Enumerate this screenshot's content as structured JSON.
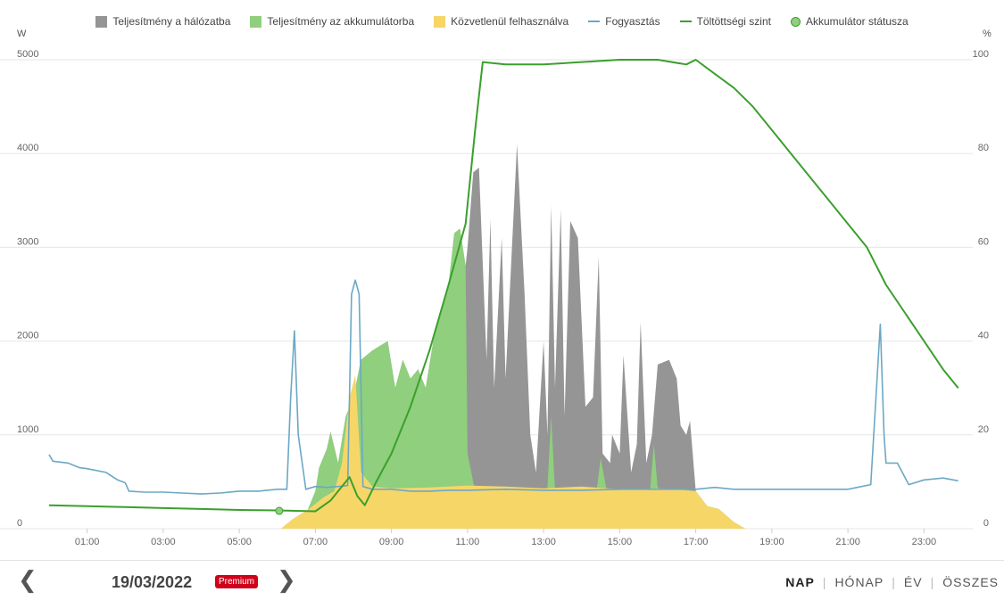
{
  "chart_data": {
    "type": "area",
    "y_left_unit": "W",
    "y_right_unit": "%",
    "y_left_ticks": [
      "0",
      "1000",
      "2000",
      "3000",
      "4000",
      "5000"
    ],
    "y_right_ticks": [
      "0",
      "20",
      "40",
      "60",
      "80",
      "100"
    ],
    "ylim_left": [
      0,
      5000
    ],
    "ylim_right": [
      0,
      100
    ],
    "x_ticks": [
      "01:00",
      "03:00",
      "05:00",
      "07:00",
      "09:00",
      "11:00",
      "13:00",
      "15:00",
      "17:00",
      "19:00",
      "21:00",
      "23:00"
    ],
    "grid": true,
    "legend_position": "top",
    "series": [
      {
        "name": "Közvetlenül felhasználva",
        "kind": "area",
        "unit": "W",
        "color": "#f7d668",
        "points": [
          [
            6.1,
            0
          ],
          [
            6.4,
            100
          ],
          [
            6.8,
            200
          ],
          [
            7.2,
            330
          ],
          [
            7.5,
            400
          ],
          [
            7.7,
            700
          ],
          [
            7.9,
            1400
          ],
          [
            8.05,
            1640
          ],
          [
            8.2,
            600
          ],
          [
            8.5,
            450
          ],
          [
            9,
            430
          ],
          [
            10,
            440
          ],
          [
            11,
            460
          ],
          [
            12,
            450
          ],
          [
            13,
            430
          ],
          [
            14,
            450
          ],
          [
            15,
            420
          ],
          [
            16,
            430
          ],
          [
            16.5,
            420
          ],
          [
            17,
            400
          ],
          [
            17.3,
            240
          ],
          [
            17.6,
            210
          ],
          [
            18,
            70
          ],
          [
            18.3,
            0
          ]
        ]
      },
      {
        "name": "Teljesítmény az akkumulátorba",
        "kind": "area",
        "unit": "W",
        "color": "#8fcf7d",
        "points": [
          [
            6.1,
            0
          ],
          [
            6.4,
            100
          ],
          [
            6.8,
            200
          ],
          [
            7,
            400
          ],
          [
            7.1,
            650
          ],
          [
            7.3,
            850
          ],
          [
            7.4,
            1030
          ],
          [
            7.6,
            700
          ],
          [
            7.8,
            1200
          ],
          [
            8,
            1400
          ],
          [
            8.2,
            1800
          ],
          [
            8.5,
            1900
          ],
          [
            8.9,
            2000
          ],
          [
            9.1,
            1500
          ],
          [
            9.3,
            1800
          ],
          [
            9.5,
            1600
          ],
          [
            9.7,
            1700
          ],
          [
            9.9,
            1500
          ],
          [
            10.1,
            2000
          ],
          [
            10.3,
            2300
          ],
          [
            10.5,
            2600
          ],
          [
            10.65,
            3150
          ],
          [
            10.8,
            3200
          ],
          [
            10.95,
            2800
          ],
          [
            11,
            800
          ],
          [
            11.2,
            400
          ],
          [
            13.1,
            430
          ],
          [
            13.2,
            1200
          ],
          [
            13.3,
            400
          ],
          [
            14.4,
            430
          ],
          [
            14.5,
            750
          ],
          [
            14.65,
            420
          ],
          [
            15.8,
            420
          ],
          [
            15.9,
            900
          ],
          [
            16,
            430
          ],
          [
            17,
            400
          ],
          [
            17.3,
            240
          ],
          [
            17.6,
            210
          ],
          [
            18,
            70
          ],
          [
            18.3,
            0
          ]
        ]
      },
      {
        "name": "Teljesítmény a hálózatba",
        "kind": "area",
        "unit": "W",
        "color": "#959595",
        "points": [
          [
            6.1,
            0
          ],
          [
            6.4,
            100
          ],
          [
            6.8,
            200
          ],
          [
            7,
            400
          ],
          [
            7.1,
            650
          ],
          [
            7.3,
            850
          ],
          [
            7.4,
            1030
          ],
          [
            7.6,
            700
          ],
          [
            7.8,
            1200
          ],
          [
            8,
            1400
          ],
          [
            8.2,
            1800
          ],
          [
            8.5,
            1900
          ],
          [
            8.9,
            2000
          ],
          [
            9.1,
            1500
          ],
          [
            9.3,
            1800
          ],
          [
            9.5,
            1600
          ],
          [
            9.7,
            1700
          ],
          [
            9.9,
            1500
          ],
          [
            10.1,
            2000
          ],
          [
            10.3,
            2300
          ],
          [
            10.5,
            2600
          ],
          [
            10.65,
            3150
          ],
          [
            10.8,
            3200
          ],
          [
            10.95,
            2800
          ],
          [
            11,
            3000
          ],
          [
            11.15,
            3800
          ],
          [
            11.3,
            3850
          ],
          [
            11.5,
            1800
          ],
          [
            11.6,
            3300
          ],
          [
            11.7,
            1500
          ],
          [
            11.9,
            3100
          ],
          [
            12,
            1600
          ],
          [
            12.3,
            4100
          ],
          [
            12.5,
            2500
          ],
          [
            12.65,
            1000
          ],
          [
            12.8,
            600
          ],
          [
            13,
            2000
          ],
          [
            13.1,
            1000
          ],
          [
            13.2,
            3450
          ],
          [
            13.3,
            1500
          ],
          [
            13.45,
            3400
          ],
          [
            13.55,
            1200
          ],
          [
            13.7,
            3280
          ],
          [
            13.9,
            3100
          ],
          [
            14.1,
            1300
          ],
          [
            14.3,
            1400
          ],
          [
            14.45,
            2900
          ],
          [
            14.55,
            800
          ],
          [
            14.75,
            700
          ],
          [
            14.8,
            1000
          ],
          [
            15,
            800
          ],
          [
            15.1,
            1850
          ],
          [
            15.3,
            600
          ],
          [
            15.45,
            900
          ],
          [
            15.55,
            2200
          ],
          [
            15.7,
            700
          ],
          [
            15.85,
            1000
          ],
          [
            16,
            1750
          ],
          [
            16.3,
            1800
          ],
          [
            16.5,
            1600
          ],
          [
            16.6,
            1100
          ],
          [
            16.75,
            1000
          ],
          [
            16.85,
            1150
          ],
          [
            17,
            400
          ],
          [
            17.3,
            240
          ],
          [
            17.6,
            210
          ],
          [
            18,
            70
          ],
          [
            18.3,
            0
          ]
        ]
      },
      {
        "name": "Fogyasztás",
        "kind": "line",
        "unit": "W",
        "color": "#6ba8c6",
        "points": [
          [
            0,
            790
          ],
          [
            0.1,
            720
          ],
          [
            0.5,
            700
          ],
          [
            0.8,
            650
          ],
          [
            1,
            640
          ],
          [
            1.5,
            600
          ],
          [
            1.8,
            520
          ],
          [
            2,
            490
          ],
          [
            2.1,
            400
          ],
          [
            2.5,
            390
          ],
          [
            3,
            390
          ],
          [
            3.5,
            380
          ],
          [
            4,
            370
          ],
          [
            4.5,
            380
          ],
          [
            5,
            400
          ],
          [
            5.5,
            400
          ],
          [
            6,
            420
          ],
          [
            6.25,
            420
          ],
          [
            6.35,
            1400
          ],
          [
            6.45,
            2110
          ],
          [
            6.55,
            1000
          ],
          [
            6.75,
            420
          ],
          [
            7,
            450
          ],
          [
            7.3,
            440
          ],
          [
            7.6,
            450
          ],
          [
            7.85,
            460
          ],
          [
            7.95,
            2500
          ],
          [
            8.05,
            2650
          ],
          [
            8.15,
            2500
          ],
          [
            8.25,
            450
          ],
          [
            8.5,
            420
          ],
          [
            9,
            420
          ],
          [
            9.5,
            400
          ],
          [
            10,
            400
          ],
          [
            10.5,
            410
          ],
          [
            11,
            410
          ],
          [
            12,
            420
          ],
          [
            13,
            410
          ],
          [
            14,
            410
          ],
          [
            15,
            420
          ],
          [
            16,
            420
          ],
          [
            17,
            420
          ],
          [
            17.5,
            440
          ],
          [
            18,
            420
          ],
          [
            19,
            420
          ],
          [
            20,
            420
          ],
          [
            21,
            420
          ],
          [
            21.6,
            470
          ],
          [
            21.85,
            2180
          ],
          [
            21.95,
            1000
          ],
          [
            22,
            700
          ],
          [
            22.3,
            700
          ],
          [
            22.6,
            470
          ],
          [
            23,
            520
          ],
          [
            23.5,
            540
          ],
          [
            23.9,
            510
          ]
        ]
      },
      {
        "name": "Töltöttségi szint",
        "kind": "line",
        "unit": "%",
        "color": "#3aa02c",
        "points": [
          [
            0,
            5
          ],
          [
            1,
            4.8
          ],
          [
            2,
            4.6
          ],
          [
            3,
            4.4
          ],
          [
            4,
            4.2
          ],
          [
            5,
            4
          ],
          [
            6,
            3.9
          ],
          [
            6.5,
            3.8
          ],
          [
            7,
            3.7
          ],
          [
            7.4,
            6
          ],
          [
            7.9,
            11
          ],
          [
            8.1,
            7
          ],
          [
            8.3,
            5
          ],
          [
            8.6,
            10
          ],
          [
            9,
            16
          ],
          [
            9.5,
            26
          ],
          [
            10,
            38
          ],
          [
            10.5,
            52
          ],
          [
            10.95,
            65
          ],
          [
            11.2,
            85
          ],
          [
            11.4,
            99.5
          ],
          [
            12,
            99
          ],
          [
            13,
            99
          ],
          [
            14,
            99.5
          ],
          [
            15,
            100
          ],
          [
            16,
            100
          ],
          [
            16.75,
            99
          ],
          [
            17,
            100
          ],
          [
            17.5,
            97
          ],
          [
            18,
            94
          ],
          [
            18.5,
            90
          ],
          [
            19,
            85
          ],
          [
            19.5,
            80
          ],
          [
            20,
            75
          ],
          [
            20.5,
            70
          ],
          [
            21,
            65
          ],
          [
            21.5,
            60
          ],
          [
            21.75,
            56
          ],
          [
            22,
            52
          ],
          [
            22.5,
            46
          ],
          [
            23,
            40
          ],
          [
            23.5,
            34
          ],
          [
            23.9,
            30
          ]
        ]
      }
    ],
    "battery_status_markers": {
      "name": "Akkumulátor státusza",
      "color": "#8fcf7d",
      "border": "#3aa02c",
      "points": [
        [
          6.05,
          3.8
        ]
      ]
    },
    "legend": [
      {
        "label": "Teljesítmény a hálózatba",
        "kind": "box",
        "color": "#959595"
      },
      {
        "label": "Teljesítmény az akkumulátorba",
        "kind": "box",
        "color": "#8fcf7d"
      },
      {
        "label": "Közvetlenül felhasználva",
        "kind": "box",
        "color": "#f7d668"
      },
      {
        "label": "Fogyasztás",
        "kind": "line",
        "color": "#6ba8c6"
      },
      {
        "label": "Töltöttségi szint",
        "kind": "line",
        "color": "#3aa02c"
      },
      {
        "label": "Akkumulátor státusza",
        "kind": "dot",
        "color": "#8fcf7d"
      }
    ]
  },
  "footer": {
    "prev_icon": "chevron-left-icon",
    "next_icon": "chevron-right-icon",
    "prev_glyph": "❮",
    "next_glyph": "❯",
    "date": "19/03/2022",
    "premium_badge": "Premium",
    "periods": [
      "NAP",
      "HÓNAP",
      "ÉV",
      "ÖSSZES"
    ],
    "active_period": "NAP"
  }
}
